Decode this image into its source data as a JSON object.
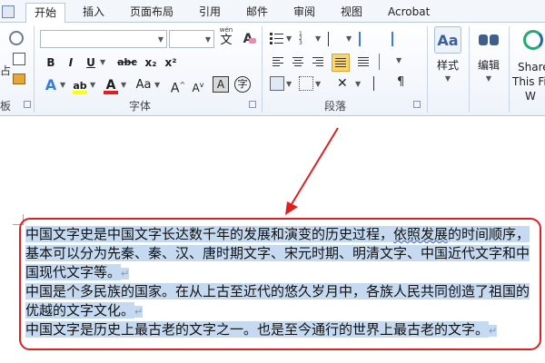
{
  "tabs": [
    {
      "label": "开始",
      "active": true
    },
    {
      "label": "插入"
    },
    {
      "label": "页面布局"
    },
    {
      "label": "引用"
    },
    {
      "label": "邮件"
    },
    {
      "label": "审阅"
    },
    {
      "label": "视图"
    },
    {
      "label": "Acrobat"
    }
  ],
  "font_group": {
    "label": "字体",
    "bold": "B",
    "italic": "I",
    "underline": "U",
    "strikethrough": "abc",
    "subscript": "x₂",
    "superscript": "x²",
    "case": "Aa",
    "grow": "A",
    "shrink": "A",
    "phonetic": "wén",
    "char_border": "A",
    "enclose": "字",
    "clear": "A",
    "text_effect": "A",
    "highlight": "ab",
    "font_color": "A",
    "shading": "A"
  },
  "paragraph_group": {
    "label": "段落"
  },
  "styles_group": {
    "styles_label": "样式",
    "styles_icon": "Aa",
    "editing_label": "编辑",
    "share_line1": "Share",
    "share_line2": "This Fi"
  },
  "left_cut": {
    "char1": "占",
    "char2": "板"
  },
  "document": {
    "p1_a": "中国文字史是中国文字长达数千年的发展和演变的历史过程，",
    "p1_b": "依照发展",
    "p1_c": "的时间顺序，基本可以分为先秦、秦、汉、唐时期文字、宋元时期、明清文字、中国近代文字和中国现代文字等。",
    "p2": "中国是个多民族的国家。在从上古至近代的悠久岁月中，各族人民共同创造了祖国的优越的文字文化。",
    "p3": "中国文字是历史上最古老的文字之一。也是至今通行的世界上最古老的文字。",
    "para_mark": "↵"
  },
  "colors": {
    "annotation": "#e02020",
    "selection": "#c5d9f0",
    "highlight": "#ffff00",
    "font_color": "#e02020"
  }
}
